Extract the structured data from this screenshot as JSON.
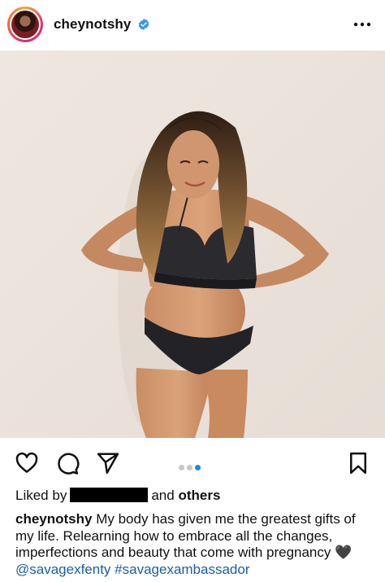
{
  "post": {
    "username": "cheynotshy",
    "more_icon": "more-horizontal-icon",
    "verified_icon": "verified-badge-icon"
  },
  "actions": {
    "like_icon": "heart-icon",
    "comment_icon": "comment-icon",
    "share_icon": "send-icon",
    "save_icon": "bookmark-icon",
    "carousel_count": 3,
    "carousel_active": 3
  },
  "likes": {
    "prefix": "Liked by",
    "connector": "and",
    "others": "others"
  },
  "caption": {
    "username": "cheynotshy",
    "text": "My body has given me the greatest gifts of my life. Relearning how to embrace all the changes, imperfections and beauty that come with pregnancy",
    "emoji": "🖤",
    "tags": [
      "@savagexfenty",
      "#savagexambassador"
    ]
  },
  "colors": {
    "link": "#1a5fa8",
    "carousel_active": "#1e88e5",
    "background": "#ffffff"
  }
}
